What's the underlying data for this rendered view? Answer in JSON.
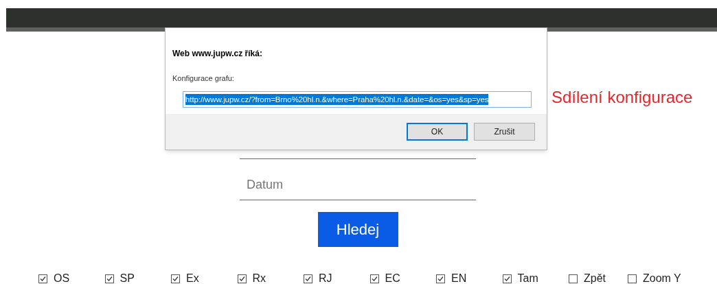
{
  "dialog": {
    "title": "Web www.jupw.cz říká:",
    "message": "Konfigurace grafu:",
    "value": "http://www.jupw.cz/?from=Brno%20hl.n.&where=Praha%20hl.n.&date=&os=yes&sp=yes",
    "buttons": [
      {
        "label": "OK",
        "selected": true
      },
      {
        "label": "Zrušit",
        "selected": false
      }
    ]
  },
  "annotation": "Sdílení konfigurace",
  "date_field": {
    "placeholder": "Datum"
  },
  "search_button": "Hledej",
  "options": [
    {
      "label": "OS",
      "checked": true
    },
    {
      "label": "SP",
      "checked": true
    },
    {
      "label": "Ex",
      "checked": true
    },
    {
      "label": "Rx",
      "checked": true
    },
    {
      "label": "RJ",
      "checked": true
    },
    {
      "label": "EC",
      "checked": true
    },
    {
      "label": "EN",
      "checked": true
    },
    {
      "label": "Tam",
      "checked": true
    },
    {
      "label": "Zpět",
      "checked": false
    },
    {
      "label": "Zoom Y",
      "checked": false
    }
  ]
}
